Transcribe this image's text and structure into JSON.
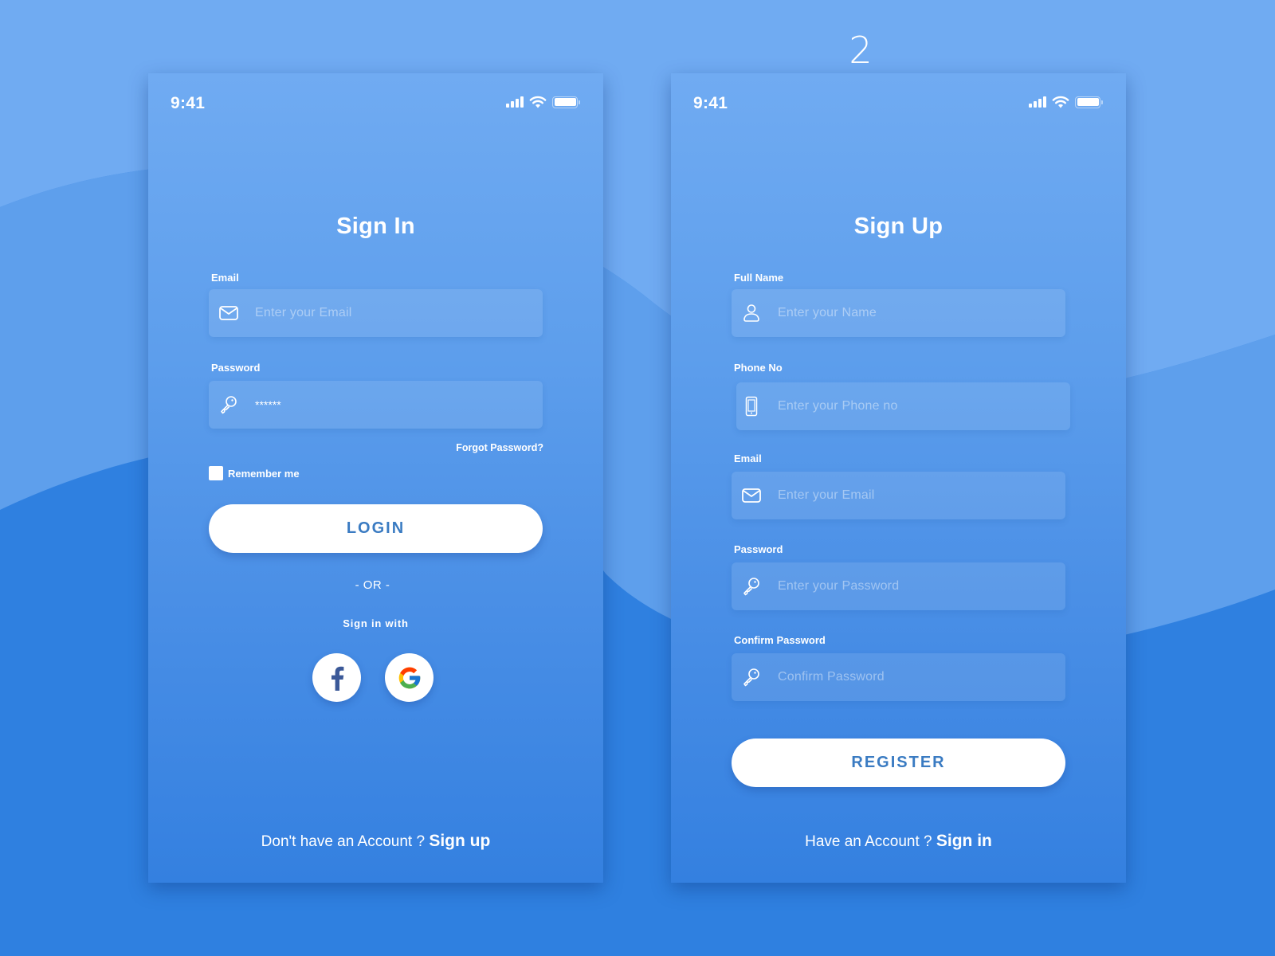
{
  "screen_number": "2",
  "colors": {
    "background_dark": "#2f80e0",
    "background_mid": "#5e9fec",
    "background_light": "#70abf2",
    "button_text": "#3a7bc2",
    "facebook": "#3b5998"
  },
  "sign_in": {
    "status_bar": {
      "time": "9:41",
      "icons": [
        "signal-icon",
        "wifi-icon",
        "battery-icon"
      ]
    },
    "title": "Sign In",
    "email": {
      "label": "Email",
      "placeholder": "Enter your Email",
      "icon": "mail-icon"
    },
    "password": {
      "label": "Password",
      "value": "******",
      "icon": "key-icon"
    },
    "forgot_password": "Forgot Password?",
    "remember_me": {
      "label": "Remember me",
      "checked": false
    },
    "login_button": "LOGIN",
    "or_separator": "- OR -",
    "sign_in_with": "Sign in with",
    "social": [
      {
        "name": "facebook",
        "icon": "facebook-icon"
      },
      {
        "name": "google",
        "icon": "google-icon"
      }
    ],
    "footer": {
      "prompt": "Don't have an Account ?",
      "link": "Sign up"
    }
  },
  "sign_up": {
    "status_bar": {
      "time": "9:41",
      "icons": [
        "signal-icon",
        "wifi-icon",
        "battery-icon"
      ]
    },
    "title": "Sign Up",
    "fields": [
      {
        "label": "Full Name",
        "placeholder": "Enter your Name",
        "icon": "user-icon"
      },
      {
        "label": "Phone No",
        "placeholder": "Enter your Phone no",
        "icon": "phone-icon"
      },
      {
        "label": "Email",
        "placeholder": "Enter your Email",
        "icon": "mail-icon"
      },
      {
        "label": "Password",
        "placeholder": "Enter your Password",
        "icon": "key-icon"
      },
      {
        "label": "Confirm Password",
        "placeholder": "Confirm Password",
        "icon": "key-icon"
      }
    ],
    "register_button": "REGISTER",
    "footer": {
      "prompt": "Have an Account ?",
      "link": "Sign in"
    }
  }
}
